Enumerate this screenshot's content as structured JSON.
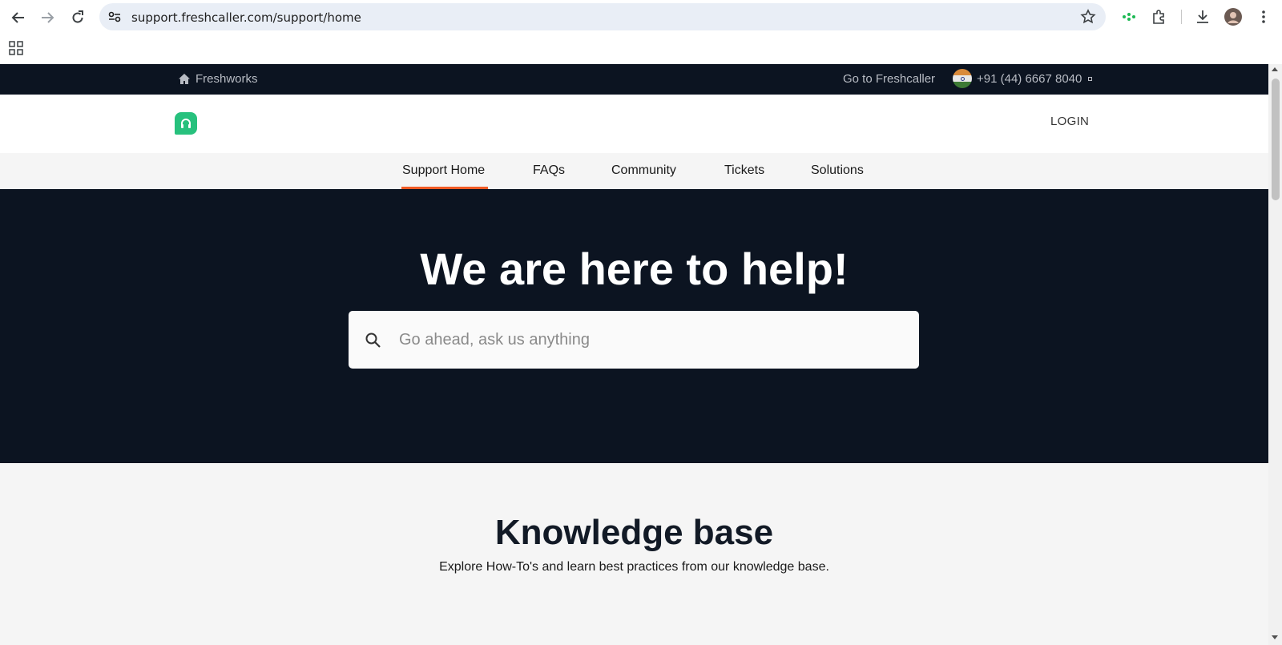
{
  "browser": {
    "url": "support.freshcaller.com/support/home"
  },
  "topbar": {
    "home_label": "Freshworks",
    "goto_label": "Go to Freshcaller",
    "phone": "+91 (44) 6667 8040"
  },
  "header": {
    "login_label": "LOGIN"
  },
  "tabs": [
    {
      "label": "Support Home",
      "active": true
    },
    {
      "label": "FAQs"
    },
    {
      "label": "Community"
    },
    {
      "label": "Tickets"
    },
    {
      "label": "Solutions"
    }
  ],
  "hero": {
    "title": "We are here to help!",
    "search_placeholder": "Go ahead, ask us anything"
  },
  "knowledge_base": {
    "title": "Knowledge base",
    "subtitle": "Explore How-To's and learn best practices from our knowledge base."
  },
  "colors": {
    "dark_bg": "#0c1421",
    "accent": "#f05a24",
    "logo_green": "#27c17d"
  }
}
